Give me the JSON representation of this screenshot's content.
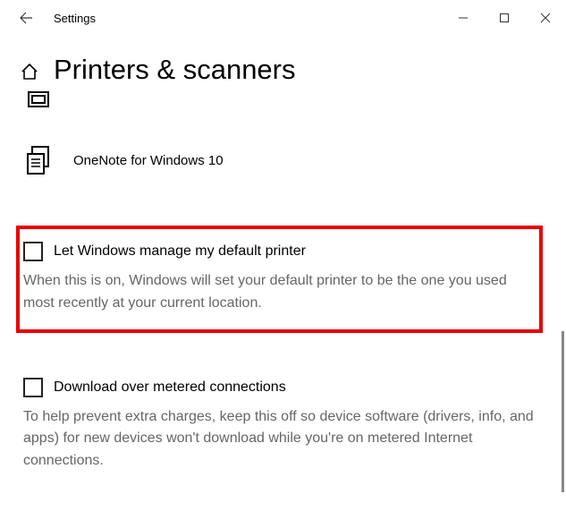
{
  "titlebar": {
    "title": "Settings"
  },
  "header": {
    "page_title": "Printers & scanners"
  },
  "devices": {
    "onenote_label": "OneNote for Windows 10"
  },
  "default_printer": {
    "label": "Let Windows manage my default printer",
    "description": "When this is on, Windows will set your default printer to be the one you used most recently at your current location."
  },
  "metered": {
    "label": "Download over metered connections",
    "description": "To help prevent extra charges, keep this off so device software (drivers, info, and apps) for new devices won't download while you're on metered Internet connections."
  }
}
